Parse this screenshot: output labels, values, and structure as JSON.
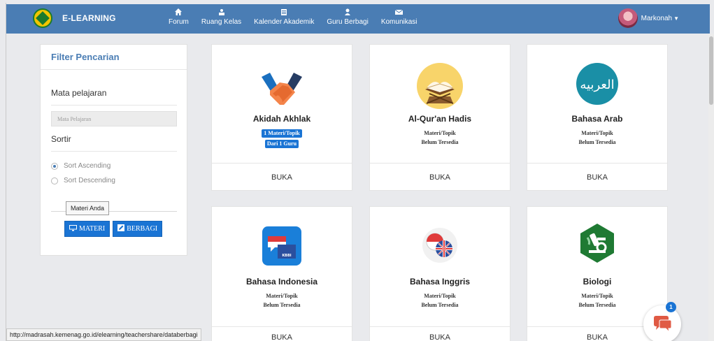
{
  "navbar": {
    "brand": "E-LEARNING",
    "items": [
      {
        "label": "Forum",
        "icon": "home-icon"
      },
      {
        "label": "Ruang Kelas",
        "icon": "class-icon"
      },
      {
        "label": "Kalender Akademik",
        "icon": "calendar-icon"
      },
      {
        "label": "Guru Berbagi",
        "icon": "teacher-icon"
      },
      {
        "label": "Komunikasi",
        "icon": "envelope-icon"
      }
    ],
    "user": "Markonah"
  },
  "filter": {
    "title": "Filter Pencarian",
    "subject_label": "Mata pelajaran",
    "subject_placeholder": "Mata Pelajaran",
    "sort_label": "Sortir",
    "sort_options": [
      "Sort Ascending",
      "Sort Descending"
    ],
    "sort_selected": "Sort Ascending",
    "tooltip": "Materi Anda",
    "btn_materi": "MATERI",
    "btn_berbagi": "BERBAGI"
  },
  "cards": [
    {
      "title": "Akidah Akhlak",
      "badge1": "1 Materi/Topik",
      "badge2": "Dari 1 Guru",
      "open": "BUKA",
      "icon": "handshake-icon"
    },
    {
      "title": "Al-Qur'an Hadis",
      "meta1": "Materi/Topik",
      "meta2": "Belum Tersedia",
      "open": "BUKA",
      "icon": "quran-icon"
    },
    {
      "title": "Bahasa Arab",
      "meta1": "Materi/Topik",
      "meta2": "Belum Tersedia",
      "open": "BUKA",
      "icon": "arabic-icon",
      "icon_text": "العربيه"
    },
    {
      "title": "Bahasa Indonesia",
      "meta1": "Materi/Topik",
      "meta2": "Belum Tersedia",
      "open": "BUKA",
      "icon": "indonesian-flag-icon",
      "icon_text": "KBBI"
    },
    {
      "title": "Bahasa Inggris",
      "meta1": "Materi/Topik",
      "meta2": "Belum Tersedia",
      "open": "BUKA",
      "icon": "language-flags-icon"
    },
    {
      "title": "Biologi",
      "meta1": "Materi/Topik",
      "meta2": "Belum Tersedia",
      "open": "BUKA",
      "icon": "microscope-icon"
    }
  ],
  "statusbar": "http://madrasah.kemenag.go.id/elearning/teachershare/databerbagi",
  "chat": {
    "count": "1"
  },
  "colors": {
    "navbar": "#4a7db4",
    "primary_button": "#1a74d4"
  }
}
